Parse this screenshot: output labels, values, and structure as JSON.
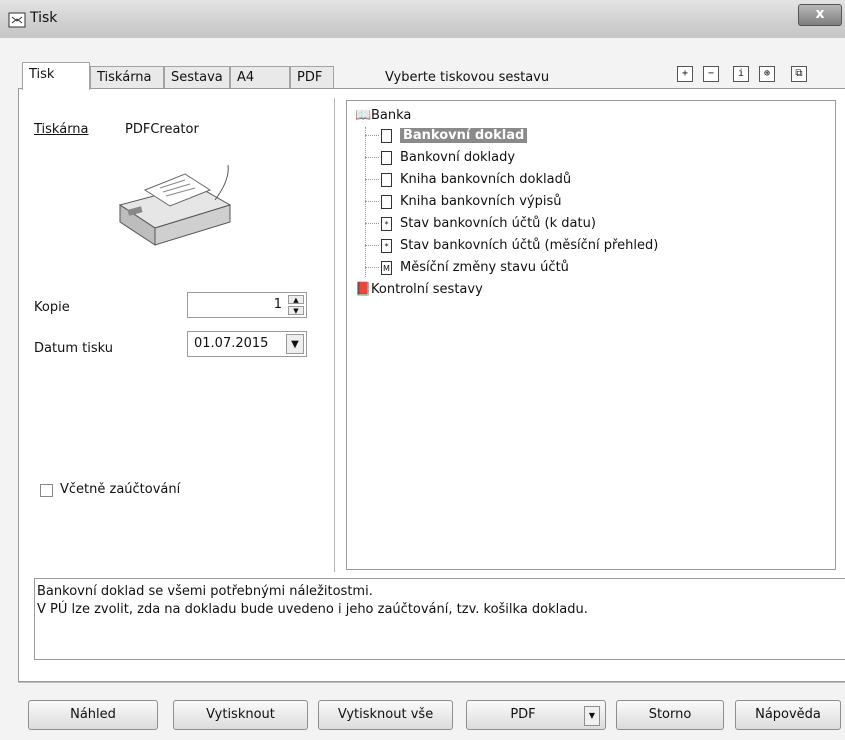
{
  "window": {
    "title": "Tisk",
    "close_label": "x"
  },
  "tabs": [
    "Tisk",
    "Tiskárna",
    "Sestava",
    "A4",
    "PDF"
  ],
  "header": {
    "select_label": "Vyberte tiskovou sestavu"
  },
  "toolbar_icons": [
    "expand-icon",
    "collapse-icon",
    "info-icon",
    "add-report-icon",
    "copy-icon"
  ],
  "left": {
    "printer_link": "Tiskárna",
    "printer_name": "PDFCreator",
    "copies_label": "Kopie",
    "copies_value": "1",
    "date_label": "Datum tisku",
    "date_value": "01.07.2015",
    "checkbox_label": "Včetně zaúčtování"
  },
  "tree": {
    "root1": "Banka",
    "items": [
      "Bankovní doklad",
      "Bankovní doklady",
      "Kniha bankovních dokladů",
      "Kniha bankovních výpisů",
      "Stav bankovních účtů (k datu)",
      "Stav bankovních účtů (měsíční přehled)",
      "Měsíční změny stavu účtů"
    ],
    "item_icons": [
      "",
      "",
      "",
      "",
      "*",
      "*",
      "M"
    ],
    "root2": "Kontrolní sestavy"
  },
  "description": {
    "line1": "Bankovní doklad se všemi potřebnými náležitostmi.",
    "line2": "V PÚ lze zvolit, zda na dokladu bude uvedeno i jeho zaúčtování, tzv. košilka dokladu."
  },
  "buttons": {
    "preview": "Náhled",
    "print": "Vytisknout",
    "print_all": "Vytisknout vše",
    "pdf": "PDF",
    "cancel": "Storno",
    "help": "Nápověda"
  }
}
